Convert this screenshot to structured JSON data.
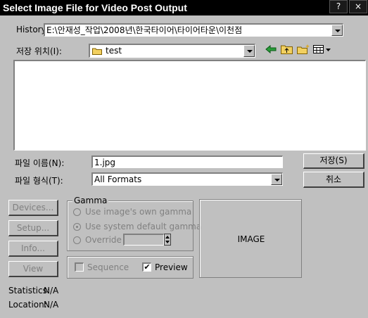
{
  "window": {
    "title": "Select Image File for Video Post Output",
    "help_button": "?",
    "close_button": "×"
  },
  "history": {
    "label": "History:",
    "path": "E:\\안재성_작업\\2008년\\한국타이어\\타이어타운\\이천점"
  },
  "save_location": {
    "label": "저장 위치(I):",
    "folder": "test"
  },
  "toolbar": {
    "back_icon": "back-arrow-icon",
    "up_icon": "folder-up-icon",
    "new_folder_icon": "new-folder-icon",
    "view_menu_icon": "view-menu-icon"
  },
  "file_name": {
    "label": "파일 이름(N):",
    "value": "1.jpg"
  },
  "file_type": {
    "label": "파일 형식(T):",
    "value": "All Formats"
  },
  "buttons": {
    "save": "저장(S)",
    "cancel": "취소",
    "devices": "Devices...",
    "setup": "Setup...",
    "info": "Info...",
    "view": "View"
  },
  "gamma": {
    "title": "Gamma",
    "option_own": "Use image's own gamma",
    "option_system": "Use system default gamma",
    "option_override": "Override",
    "selected": "system"
  },
  "options": {
    "sequence_label": "Sequence",
    "sequence_checked": false,
    "preview_label": "Preview",
    "preview_checked": true
  },
  "preview_area": {
    "label": "IMAGE"
  },
  "info": {
    "statistics_label": "Statistics:",
    "statistics_value": "N/A",
    "location_label": "Location:",
    "location_value": "N/A"
  },
  "colors": {
    "titlebar_bg": "#000000",
    "dialog_bg": "#c0c0c0",
    "folder_icon": "#f2d060"
  }
}
